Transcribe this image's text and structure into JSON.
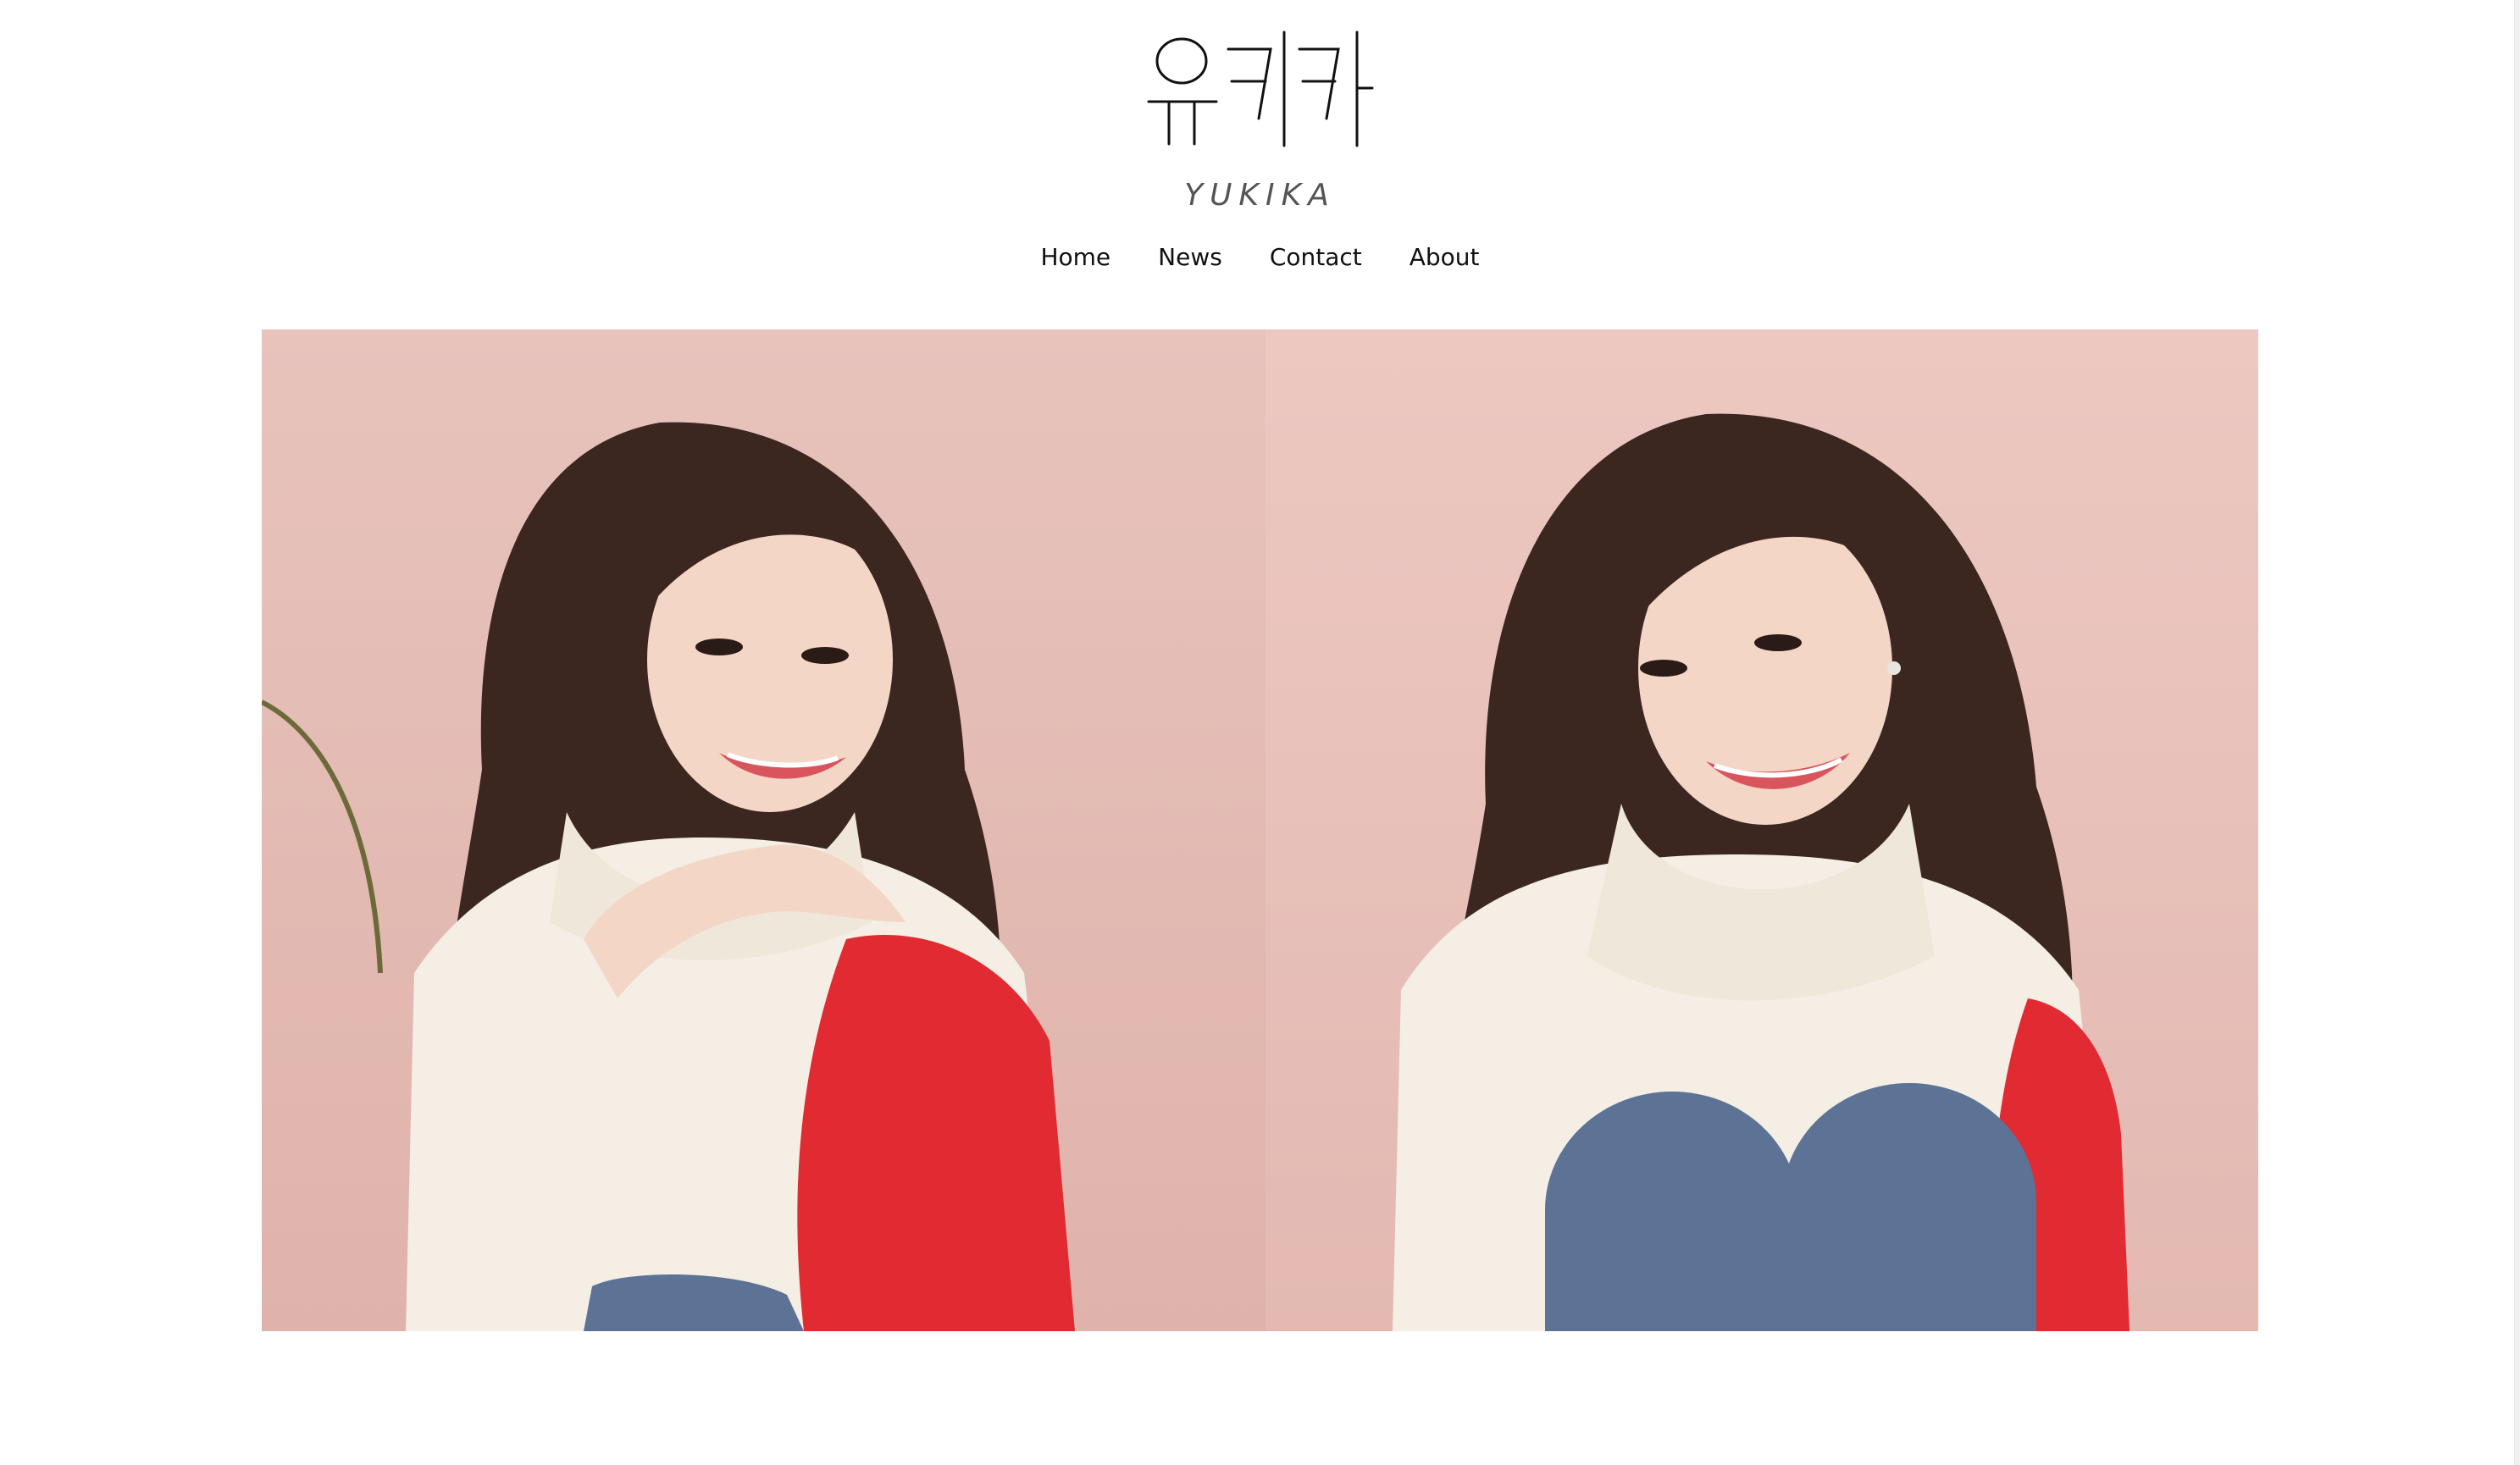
{
  "logo": {
    "hangul": "유키카",
    "roman": "YUKIKA"
  },
  "nav": {
    "items": [
      {
        "label": "Home"
      },
      {
        "label": "News"
      },
      {
        "label": "Contact"
      },
      {
        "label": "About"
      }
    ]
  },
  "gallery": {
    "photos": [
      {
        "subject": "woman with hands clasped under chin, white turtleneck with red sleeve, pink background"
      },
      {
        "subject": "woman smiling with knees up, white turtleneck, jeans, pink background"
      }
    ]
  },
  "colors": {
    "background": "#ffffff",
    "photo_backdrop": "#e7c3bc",
    "sweater": "#f4eee4",
    "sleeve": "#e12a32",
    "hair": "#3b2620",
    "jeans": "#5c7396"
  }
}
